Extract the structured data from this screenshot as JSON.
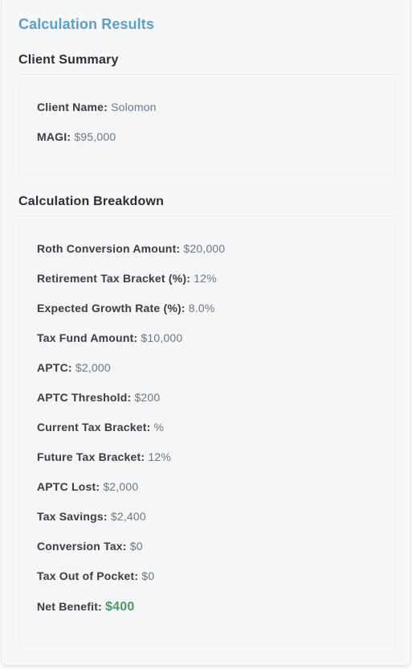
{
  "results_title": "Calculation Results",
  "client_summary": {
    "title": "Client Summary",
    "rows": [
      {
        "label": "Client Name:",
        "value": "Solomon"
      },
      {
        "label": "MAGI:",
        "value": "$95,000"
      }
    ]
  },
  "breakdown": {
    "title": "Calculation Breakdown",
    "rows": [
      {
        "label": "Roth Conversion Amount:",
        "value": "$20,000"
      },
      {
        "label": "Retirement Tax Bracket (%):",
        "value": "12%"
      },
      {
        "label": "Expected Growth Rate (%):",
        "value": "8.0%"
      },
      {
        "label": "Tax Fund Amount:",
        "value": "$10,000"
      },
      {
        "label": "APTC:",
        "value": "$2,000"
      },
      {
        "label": "APTC Threshold:",
        "value": "$200"
      },
      {
        "label": "Current Tax Bracket:",
        "value": "%"
      },
      {
        "label": "Future Tax Bracket:",
        "value": "12%"
      },
      {
        "label": "APTC Lost:",
        "value": "$2,000"
      },
      {
        "label": "Tax Savings:",
        "value": "$2,400"
      },
      {
        "label": "Conversion Tax:",
        "value": "$0"
      },
      {
        "label": "Tax Out of Pocket:",
        "value": "$0"
      },
      {
        "label": "Net Benefit:",
        "value": "$400"
      }
    ]
  },
  "colors": {
    "accent_title": "#5b9ec7",
    "net_benefit": "#4f9a63"
  }
}
